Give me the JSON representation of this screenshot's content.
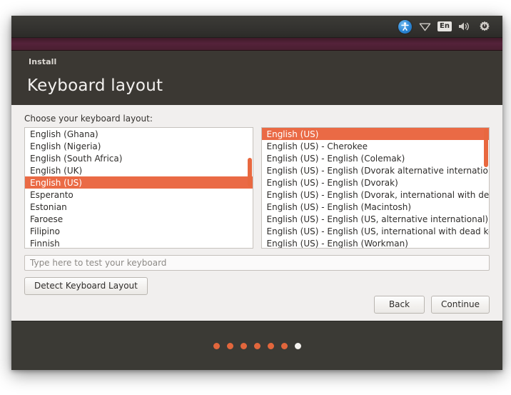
{
  "top_panel": {
    "icons": [
      {
        "name": "accessibility-icon",
        "glyph": "accessibility"
      },
      {
        "name": "network-icon",
        "glyph": "network"
      },
      {
        "name": "keyboard-indicator",
        "label": "En"
      },
      {
        "name": "volume-icon",
        "glyph": "volume"
      },
      {
        "name": "power-gear-icon",
        "glyph": "gear"
      }
    ]
  },
  "window": {
    "app_label": "Install",
    "page_title": "Keyboard layout"
  },
  "content": {
    "choose_label": "Choose your keyboard layout:",
    "language_list": [
      {
        "label": "English (Ghana)",
        "selected": false
      },
      {
        "label": "English (Nigeria)",
        "selected": false
      },
      {
        "label": "English (South Africa)",
        "selected": false
      },
      {
        "label": "English (UK)",
        "selected": false
      },
      {
        "label": "English (US)",
        "selected": true
      },
      {
        "label": "Esperanto",
        "selected": false
      },
      {
        "label": "Estonian",
        "selected": false
      },
      {
        "label": "Faroese",
        "selected": false
      },
      {
        "label": "Filipino",
        "selected": false
      },
      {
        "label": "Finnish",
        "selected": false
      }
    ],
    "variant_list": [
      {
        "label": "English (US)",
        "selected": true
      },
      {
        "label": "English (US) - Cherokee",
        "selected": false
      },
      {
        "label": "English (US) - English (Colemak)",
        "selected": false
      },
      {
        "label": "English (US) - English (Dvorak alternative international no dead keys)",
        "selected": false
      },
      {
        "label": "English (US) - English (Dvorak)",
        "selected": false
      },
      {
        "label": "English (US) - English (Dvorak, international with dead keys)",
        "selected": false
      },
      {
        "label": "English (US) - English (Macintosh)",
        "selected": false
      },
      {
        "label": "English (US) - English (US, alternative international)",
        "selected": false
      },
      {
        "label": "English (US) - English (US, international with dead keys)",
        "selected": false
      },
      {
        "label": "English (US) - English (Workman)",
        "selected": false
      }
    ],
    "test_input_placeholder": "Type here to test your keyboard",
    "test_input_value": "",
    "detect_button_label": "Detect Keyboard Layout",
    "back_button_label": "Back",
    "continue_button_label": "Continue"
  },
  "footer": {
    "dots": [
      {
        "current": false
      },
      {
        "current": false
      },
      {
        "current": false
      },
      {
        "current": false
      },
      {
        "current": false
      },
      {
        "current": false
      },
      {
        "current": true
      }
    ]
  },
  "colors": {
    "accent_orange": "#ea6a45",
    "header_dark": "#3b3833",
    "title_strip_maroon": "#4a1f31",
    "footer_dark": "#3b3a35",
    "content_bg": "#f1efee"
  }
}
